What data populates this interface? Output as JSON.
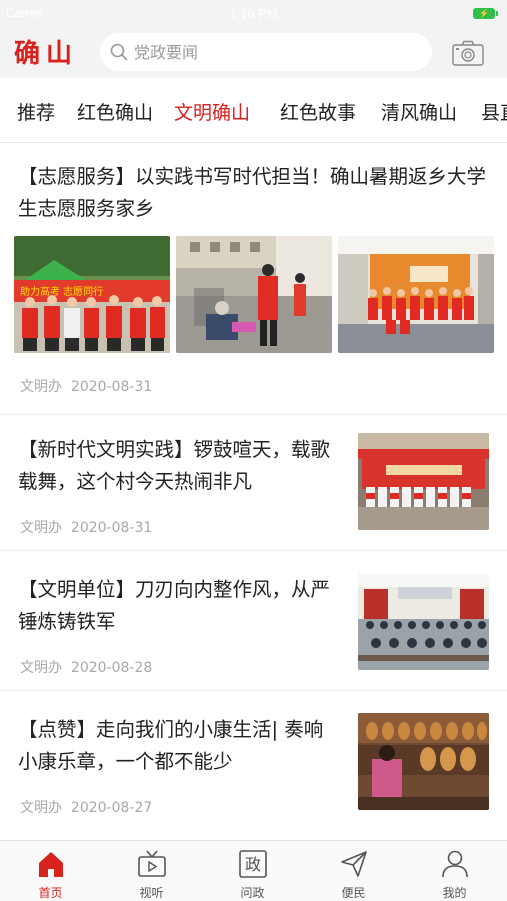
{
  "status_bar": {
    "carrier": "Carrier",
    "time": "1:16 PM"
  },
  "header": {
    "logo": "确山",
    "search_placeholder": "党政要闻"
  },
  "tabs": [
    {
      "label": "推荐"
    },
    {
      "label": "红色确山"
    },
    {
      "label": "文明确山",
      "active": true
    },
    {
      "label": "红色故事"
    },
    {
      "label": "清风确山"
    },
    {
      "label": "县直"
    }
  ],
  "feature": {
    "title": "【志愿服务】以实践书写时代担当！确山暑期返乡大学生志愿服务家乡",
    "banner_text": "助力高考 志愿同行",
    "source": "文明办",
    "date": "2020-08-31"
  },
  "articles": [
    {
      "title": "【新时代文明实践】锣鼓喧天，载歌载舞，这个村今天热闹非凡",
      "source": "文明办",
      "date": "2020-08-31"
    },
    {
      "title": "【文明单位】刀刃向内整作风，从严锤炼铸铁军",
      "source": "文明办",
      "date": "2020-08-28"
    },
    {
      "title": "【点赞】走向我们的小康生活| 奏响小康乐章，一个都不能少",
      "source": "文明办",
      "date": "2020-08-27"
    }
  ],
  "bottom_nav": [
    {
      "label": "首页",
      "icon": "home-icon",
      "active": true
    },
    {
      "label": "视听",
      "icon": "tv-icon"
    },
    {
      "label": "问政",
      "icon": "zheng-icon",
      "glyph": "政"
    },
    {
      "label": "便民",
      "icon": "send-icon"
    },
    {
      "label": "我的",
      "icon": "user-icon"
    }
  ],
  "colors": {
    "accent": "#d7221e",
    "battery": "#2fbf48",
    "header_bg": "#f3f3f3"
  }
}
